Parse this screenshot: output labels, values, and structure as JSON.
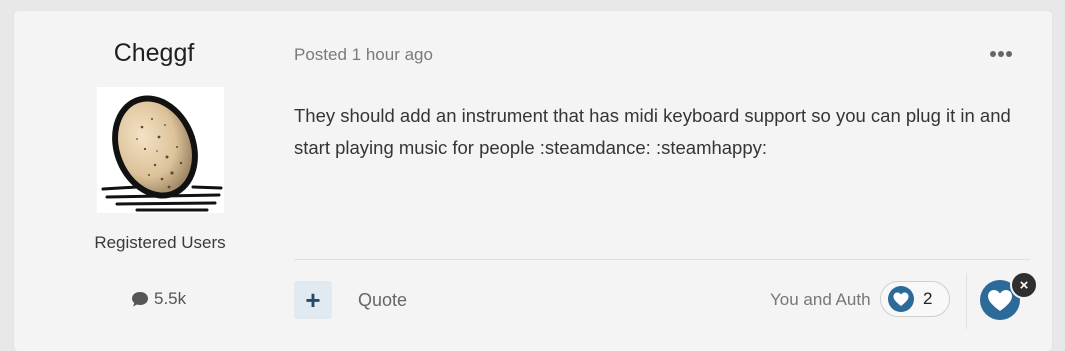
{
  "author": {
    "name": "Cheggf",
    "group": "Registered Users",
    "post_count": "5.5k"
  },
  "post": {
    "date": "Posted 1 hour ago",
    "content": "They should add an instrument that has midi keyboard support so you can plug it in and start playing music for people :steamdance: :steamhappy:"
  },
  "actions": {
    "multiquote_label": "+",
    "quote_label": "Quote",
    "remove_reaction_label": "×"
  },
  "reactions": {
    "summary": "You and Auth",
    "count": "2",
    "icon": "heart-icon"
  },
  "colors": {
    "heart": "#2b6a99",
    "accent_bg": "#e1e9f1"
  }
}
